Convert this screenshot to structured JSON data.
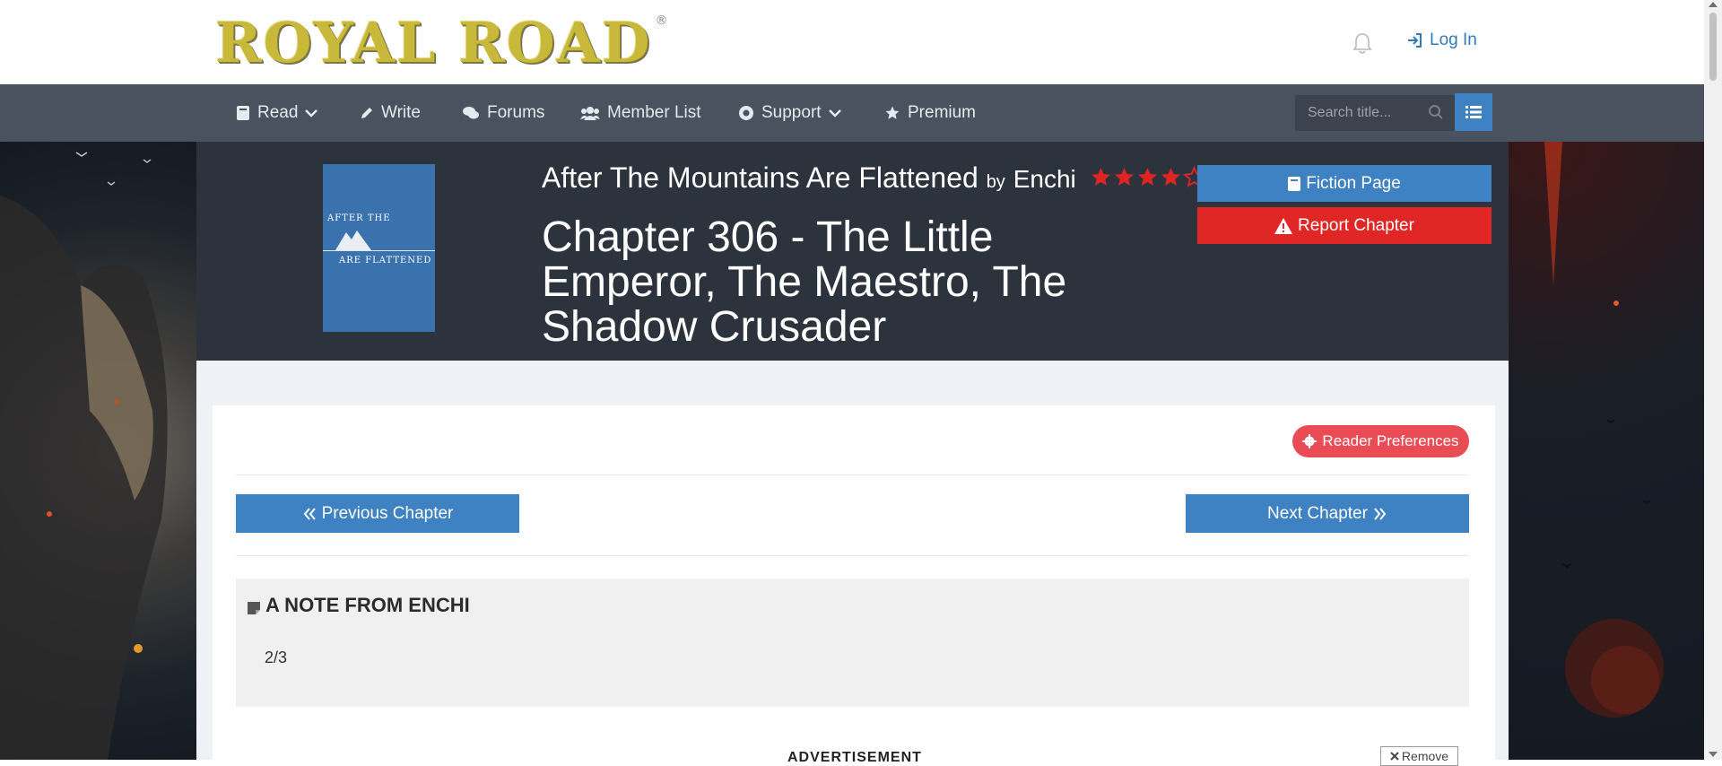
{
  "site": {
    "logo_text": "ROYAL ROAD",
    "logo_reg": "®",
    "login_label": "Log In"
  },
  "nav": {
    "items": [
      {
        "label": "Read",
        "icon": "book-icon",
        "has_dropdown": true
      },
      {
        "label": "Write",
        "icon": "pencil-icon",
        "has_dropdown": false
      },
      {
        "label": "Forums",
        "icon": "comments-icon",
        "has_dropdown": false
      },
      {
        "label": "Member List",
        "icon": "users-icon",
        "has_dropdown": false
      },
      {
        "label": "Support",
        "icon": "lifering-icon",
        "has_dropdown": true
      },
      {
        "label": "Premium",
        "icon": "star-icon",
        "has_dropdown": false
      }
    ],
    "search_placeholder": "Search title..."
  },
  "fiction": {
    "title": "After The Mountains Are Flattened",
    "by": "by",
    "author": "Enchi",
    "rating": 4,
    "rating_max": 5,
    "cover_line1": "AFTER THE",
    "cover_line2": "ARE FLATTENED"
  },
  "chapter": {
    "title": "Chapter 306 - The Little Emperor, The Maestro, The Shadow Crusader"
  },
  "actions": {
    "fiction_page": "Fiction Page",
    "report_chapter": "Report Chapter",
    "reader_preferences": "Reader Preferences"
  },
  "navigation": {
    "previous": "Previous Chapter",
    "next": "Next Chapter"
  },
  "note": {
    "title": "A NOTE FROM ENCHI",
    "body": "2/3"
  },
  "ad": {
    "label": "ADVERTISEMENT",
    "remove": "Remove"
  },
  "colors": {
    "primary": "#3f82c4",
    "danger": "#e12626",
    "pref": "#ea4c55",
    "navbar": "#4a525f",
    "header": "#2c333d",
    "star": "#e02424"
  }
}
